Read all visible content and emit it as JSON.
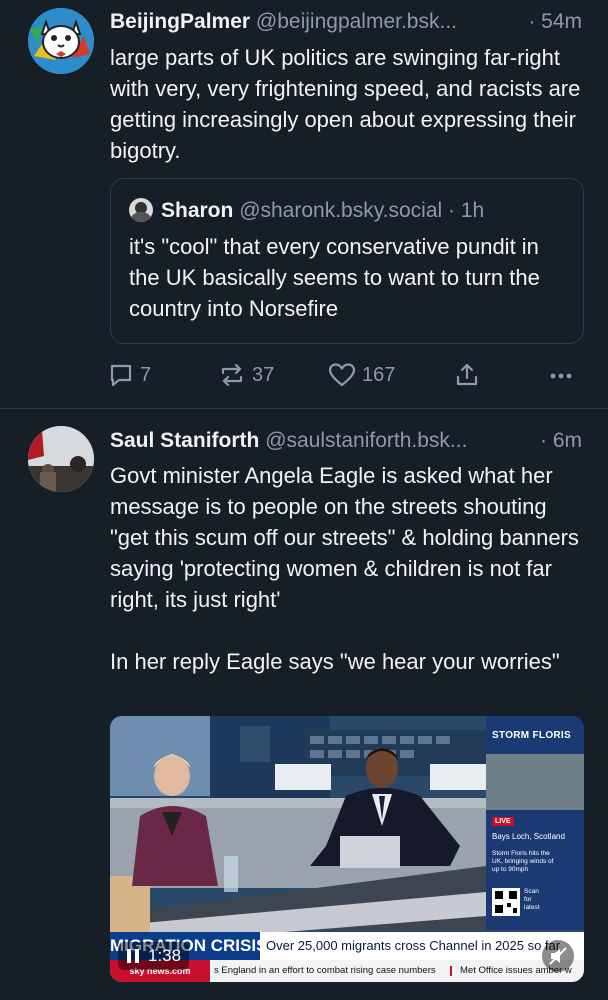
{
  "posts": [
    {
      "author": "BeijingPalmer",
      "handle": "@beijingpalmer.bsk...",
      "time": "· 54m",
      "text": "large parts of UK politics are swinging far-right with very, very frightening speed, and racists are getting increasingly open about expressing their bigotry.",
      "quote": {
        "author": "Sharon",
        "handle": "@sharonk.bsky.social",
        "time": "· 1h",
        "text": "it's \"cool\" that every conservative pundit in the UK basically seems to want to turn the country into Norsefire"
      },
      "actions": {
        "replies": "7",
        "reposts": "37",
        "likes": "167"
      }
    },
    {
      "author": "Saul Staniforth",
      "handle": "@saulstaniforth.bsk...",
      "time": "· 6m",
      "text": "Govt minister Angela Eagle is asked what her message is to people on the streets shouting \"get this scum off our streets\" & holding banners saying 'protecting women & children is not far right, its just right'\n\nIn her reply Eagle says \"we hear your worries\"",
      "video": {
        "time": "1:38",
        "side_panel": {
          "title": "STORM FLORIS",
          "live": "LIVE",
          "location": "Bays Loch, Scotland",
          "desc": "Storm Floris hits the UK, bringing winds of up to 90mph",
          "scan": "Scan for latest"
        },
        "banner_label": "MIGRATION CRISIS",
        "banner_headline": "Over 25,000 migrants cross Channel in 2025 so far",
        "ticker_brand": "sky news.com",
        "ticker_1": "s England in an effort to combat rising case numbers",
        "ticker_2": "Met Office issues amber w"
      }
    }
  ],
  "colors": {
    "background": "#161e27",
    "muted": "#8c9aab",
    "text": "#f1f3f5",
    "border": "#2e3a48",
    "accent_red": "#c8102e"
  }
}
